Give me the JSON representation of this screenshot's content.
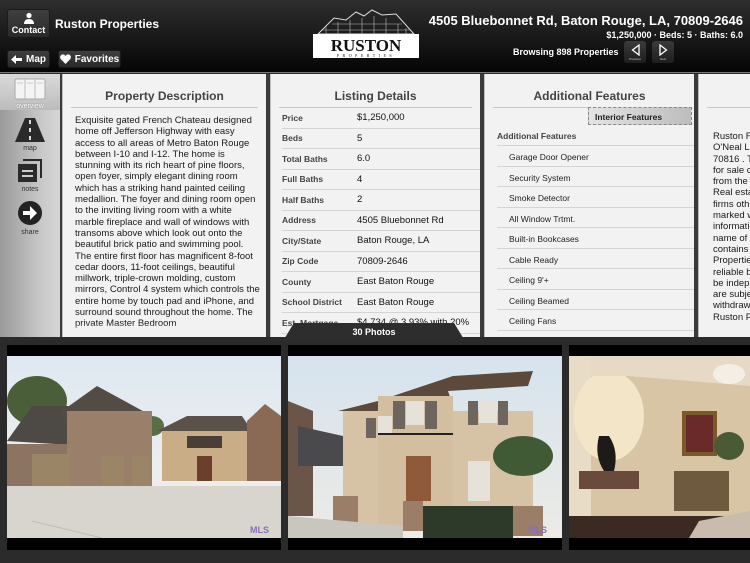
{
  "header": {
    "contact_label": "Contact",
    "agent_name": "Ruston Properties",
    "map_label": "Map",
    "favorites_label": "Favorites",
    "logo_text": "RUSTON",
    "logo_subtext": "PROPERTIES",
    "address": "4505 Bluebonnet Rd, Baton Rouge, LA, 70809-2646",
    "summary": "$1,250,000 · Beds: 5 · Baths: 6.0",
    "browsing": "Browsing 898 Properties",
    "previous_label": "Previous",
    "next_label": "Next"
  },
  "sidebar": {
    "items": [
      {
        "label": "overview",
        "icon": "overview-icon",
        "active": true
      },
      {
        "label": "map",
        "icon": "road-icon"
      },
      {
        "label": "notes",
        "icon": "notes-icon"
      },
      {
        "label": "share",
        "icon": "share-arrow-icon"
      }
    ]
  },
  "description": {
    "title": "Property Description",
    "text": "Exquisite gated French Chateau designed home off Jefferson Highway with easy access to all areas of Metro Baton Rouge between I-10 and I-12. The home is stunning with its rich heart of pine floors, open foyer, simply elegant dining room which has a striking hand painted ceiling medallion.  The foyer and dining room open to the inviting living room with a white marble fireplace and wall of windows with transoms above which look out onto the beautiful brick patio and swimming pool.    The entire first floor has magnificent 8-foot cedar doors, 11-foot ceilings, beautiful millwork, triple-crown molding, custom mirrors, Control 4 system which controls the entire home by touch pad and iPhone, and surround sound throughout the home.   The private Master Bedroom"
  },
  "listing": {
    "title": "Listing Details",
    "rows": [
      {
        "label": "Price",
        "value": "$1,250,000"
      },
      {
        "label": "Beds",
        "value": "5"
      },
      {
        "label": "Total Baths",
        "value": "6.0"
      },
      {
        "label": "Full Baths",
        "value": "4"
      },
      {
        "label": "Half Baths",
        "value": "2"
      },
      {
        "label": "Address",
        "value": "4505 Bluebonnet Rd"
      },
      {
        "label": "City/State",
        "value": "Baton Rouge, LA"
      },
      {
        "label": "Zip Code",
        "value": "70809-2646"
      },
      {
        "label": "County",
        "value": "East Baton Rouge"
      },
      {
        "label": "School District",
        "value": "East Baton Rouge"
      },
      {
        "label": "Est. Mortgage",
        "value": "$4,734 @ 3.93% with 20%"
      }
    ]
  },
  "features": {
    "title": "Additional Features",
    "tab_label": "Interior Features",
    "group_label": "Additional Features",
    "items": [
      "Garage Door Opener",
      "Security System",
      "Smoke Detector",
      "All Window Trtmt.",
      "Built-in Bookcases",
      "Cable Ready",
      "Ceiling 9'+",
      "Ceiling Beamed",
      "Ceiling Fans"
    ]
  },
  "disclaimer": {
    "lines": [
      "Ruston F",
      "O'Neal L",
      "70816 . T",
      "for sale c",
      "from the",
      "Real esta",
      "firms oth",
      "marked w",
      "informati",
      "name of",
      "contains",
      "Propertie",
      "reliable b",
      "be indep",
      "are subje",
      "withdraw",
      "Ruston P"
    ]
  },
  "photos": {
    "count_label": "30 Photos",
    "items": [
      {
        "alt": "Exterior front with three-car garage and driveway",
        "watermark": "MLS"
      },
      {
        "alt": "Front elevation with balcony and palm tree",
        "watermark": "MLS"
      },
      {
        "alt": "Interior foyer with statue and chest",
        "watermark": ""
      }
    ]
  },
  "colors": {
    "header_bg": "#111111",
    "panel_bg": "#f2f2f2",
    "gallery_bg": "#2b2b2b"
  }
}
